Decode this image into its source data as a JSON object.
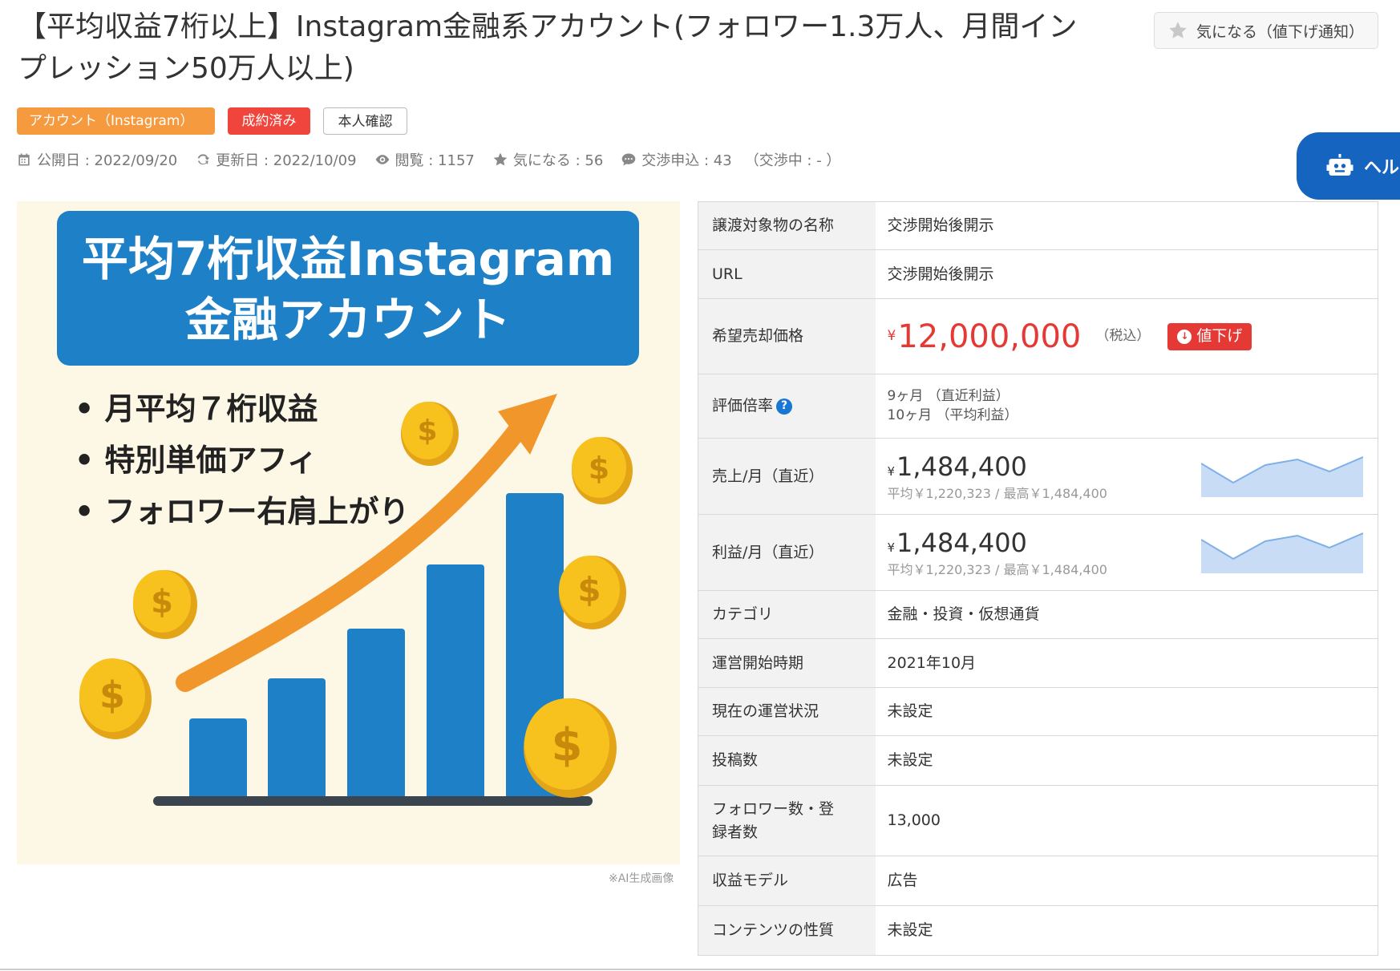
{
  "listing": {
    "title": "【平均収益7桁以上】Instagram金融系アカウント(フォロワー1.3万人、月間インプレッション50万人以上)",
    "fav_button": "気になる（値下げ通知）",
    "badges": {
      "category": "アカウント（Instagram）",
      "status": "成約済み",
      "verified": "本人確認"
    },
    "meta": {
      "published": "公開日 : 2022/09/20",
      "updated": "更新日 : 2022/10/09",
      "views": "閲覧 : 1157",
      "favorites": "気になる : 56",
      "offers": "交渉申込 : 43",
      "negotiating": "（交渉中 : - ）"
    }
  },
  "help_button": {
    "label": "ヘル"
  },
  "hero_image": {
    "headline_line1": "平均7桁収益Instagram",
    "headline_line2": "金融アカウント",
    "bullets": [
      "• 月平均７桁収益",
      "• 特別単価アフィ",
      "• フォロワー右肩上がり"
    ],
    "note": "※AI生成画像",
    "colors": {
      "background": "#fdf7e6",
      "banner": "#1e80c6",
      "bar": "#1e80c6",
      "arrow": "#f0962a",
      "coin": "#f7c21e"
    }
  },
  "spec": {
    "name_label": "譲渡対象物の名称",
    "name_value": "交渉開始後開示",
    "url_label": "URL",
    "url_value": "交渉開始後開示",
    "price_label": "希望売却価格",
    "price_currency": "¥",
    "price_value": "12,000,000",
    "price_tax": "（税込）",
    "price_down_label": "値下げ",
    "multiple_label": "評価倍率",
    "multiple_line1": "9ヶ月 （直近利益）",
    "multiple_line2": "10ヶ月 （平均利益）",
    "sales_label": "売上/月（直近）",
    "sales_currency": "¥",
    "sales_value": "1,484,400",
    "sales_stats": "平均￥1,220,323 / 最高￥1,484,400",
    "profit_label": "利益/月（直近）",
    "profit_currency": "¥",
    "profit_value": "1,484,400",
    "profit_stats": "平均￥1,220,323 / 最高￥1,484,400",
    "category_label": "カテゴリ",
    "category_value": "金融・投資・仮想通貨",
    "start_label": "運営開始時期",
    "start_value": "2021年10月",
    "status_label": "現在の運営状況",
    "status_value": "未設定",
    "posts_label": "投稿数",
    "posts_value": "未設定",
    "followers_label": "フォロワー数・登録者数",
    "followers_value": "13,000",
    "revenue_model_label": "収益モデル",
    "revenue_model_value": "広告",
    "content_label": "コンテンツの性質",
    "content_value": "未設定"
  },
  "colors": {
    "price_red": "#e53935",
    "orange": "#f59a3e",
    "status_red": "#f0453c",
    "help_blue": "#1565c0",
    "spark_fill": "#c9dcf5"
  }
}
